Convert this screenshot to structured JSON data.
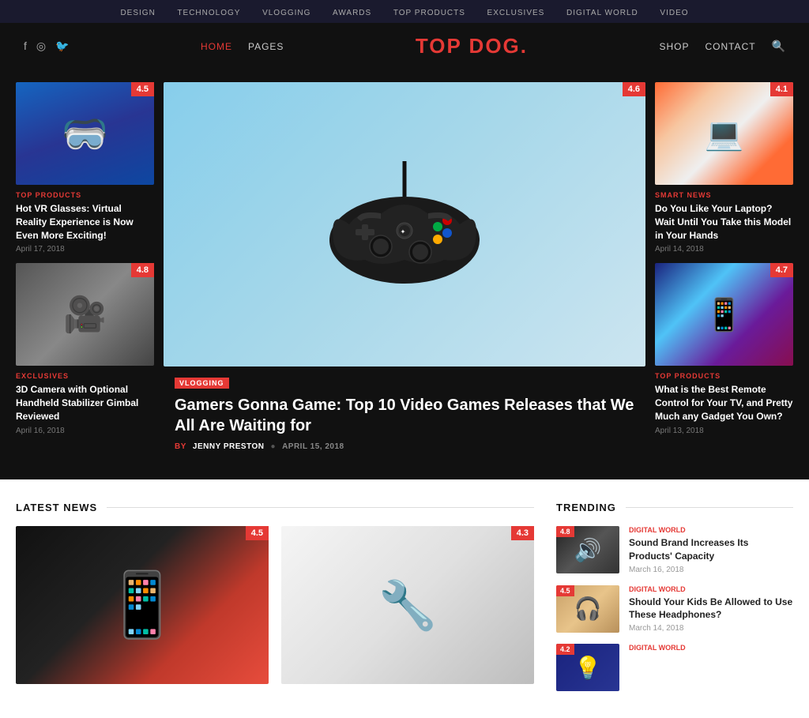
{
  "topnav": {
    "items": [
      "Design",
      "Technology",
      "Vlogging",
      "Awards",
      "Top Products",
      "Exclusives",
      "Digital World",
      "Video"
    ]
  },
  "header": {
    "social": [
      "f",
      "◎",
      "🐦"
    ],
    "nav_left": [
      {
        "label": "Home",
        "active": true
      },
      {
        "label": "Pages",
        "active": false
      }
    ],
    "logo": "TOP DOG",
    "logo_dot": ".",
    "nav_right": [
      {
        "label": "Shop"
      },
      {
        "label": "Contact"
      }
    ]
  },
  "hero": {
    "left_cards": [
      {
        "badge": "4.5",
        "category": "Top Products",
        "title": "Hot VR Glasses: Virtual Reality Experience is Now Even More Exciting!",
        "date": "April 17, 2018",
        "img_class": "img-vr"
      },
      {
        "badge": "4.8",
        "category": "Exclusives",
        "title": "3D Camera with Optional Handheld Stabilizer Gimbal Reviewed",
        "date": "April 16, 2018",
        "img_class": "img-camera"
      }
    ],
    "feature": {
      "badge": "4.6",
      "category": "Vlogging",
      "title": "Gamers Gonna Game: Top 10 Video Games Releases that We All Are Waiting for",
      "author": "Jenny Preston",
      "date": "April 15, 2018"
    },
    "right_cards": [
      {
        "badge": "4.1",
        "category": "Smart News",
        "title": "Do You Like Your Laptop? Wait Until You Take this Model in Your Hands",
        "date": "April 14, 2018",
        "img_class": "img-laptop"
      },
      {
        "badge": "4.7",
        "category": "Top Products",
        "title": "What is the Best Remote Control for Your TV, and Pretty Much any Gadget You Own?",
        "date": "April 13, 2018",
        "img_class": "img-remote"
      }
    ]
  },
  "latest_news": {
    "section_title": "Latest News",
    "cards": [
      {
        "badge": "4.5",
        "img_class": "img-phone"
      },
      {
        "badge": "4.3",
        "img_class": "img-gadget"
      }
    ]
  },
  "trending": {
    "section_title": "Trending",
    "items": [
      {
        "badge": "4.8",
        "category": "Digital World",
        "title": "Sound Brand Increases Its Products' Capacity",
        "date": "March 16, 2018",
        "img_class": "img-speaker"
      },
      {
        "badge": "4.5",
        "category": "Digital World",
        "title": "Should Your Kids Be Allowed to Use These Headphones?",
        "date": "March 14, 2018",
        "img_class": "img-headphones"
      },
      {
        "badge": "4.2",
        "category": "Digital World",
        "title": "",
        "date": "",
        "img_class": "img-trending3"
      }
    ]
  }
}
